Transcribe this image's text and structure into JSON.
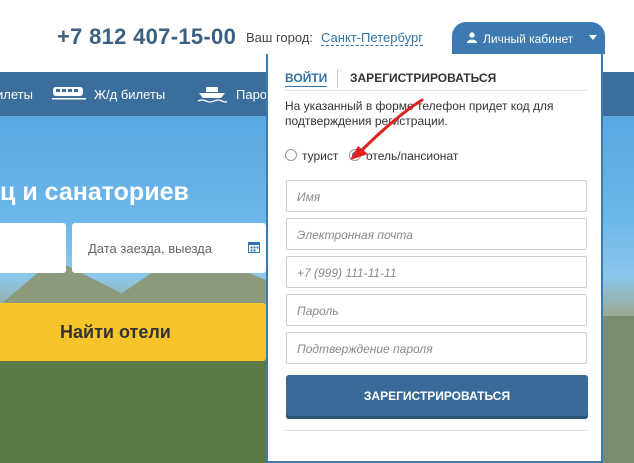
{
  "header": {
    "phone": "+7 812 407-15-00",
    "city_label": "Ваш город:",
    "city_value": "Санкт-Петербург",
    "cabinet_label": "Личный кабинет",
    "cabinet_icon": "user-icon"
  },
  "nav": {
    "items": [
      {
        "label": "илеты",
        "icon": "bus-icon"
      },
      {
        "label": "Ж/д билеты",
        "icon": "train-icon"
      },
      {
        "label": "Паро",
        "icon": "ferry-icon"
      }
    ]
  },
  "hero": {
    "title": "ц и санаториев",
    "date_placeholder": "Дата заезда, выезда",
    "search_button": "Найти отели"
  },
  "panel": {
    "tab_login": "ВОЙТИ",
    "tab_register": "ЗАРЕГИСТРИРОВАТЬСЯ",
    "info_text": "На указанный в форме телефон придет код для подтверждения регистрации.",
    "radio_tourist": "турист",
    "radio_hotel": "отель/пансионат",
    "selected_radio": "отель/пансионат",
    "fields": {
      "name": "Имя",
      "email": "Электронная почта",
      "phone": "+7 (999) 111-11-11",
      "password": "Пароль",
      "password_confirm": "Подтверждение пароля"
    },
    "submit_label": "ЗАРЕГИСТРИРОВАТЬСЯ"
  },
  "colors": {
    "primary_blue": "#3d7ab1",
    "nav_blue": "#3b6e9c",
    "accent_yellow": "#f7c52b",
    "arrow_red": "#e02020"
  }
}
